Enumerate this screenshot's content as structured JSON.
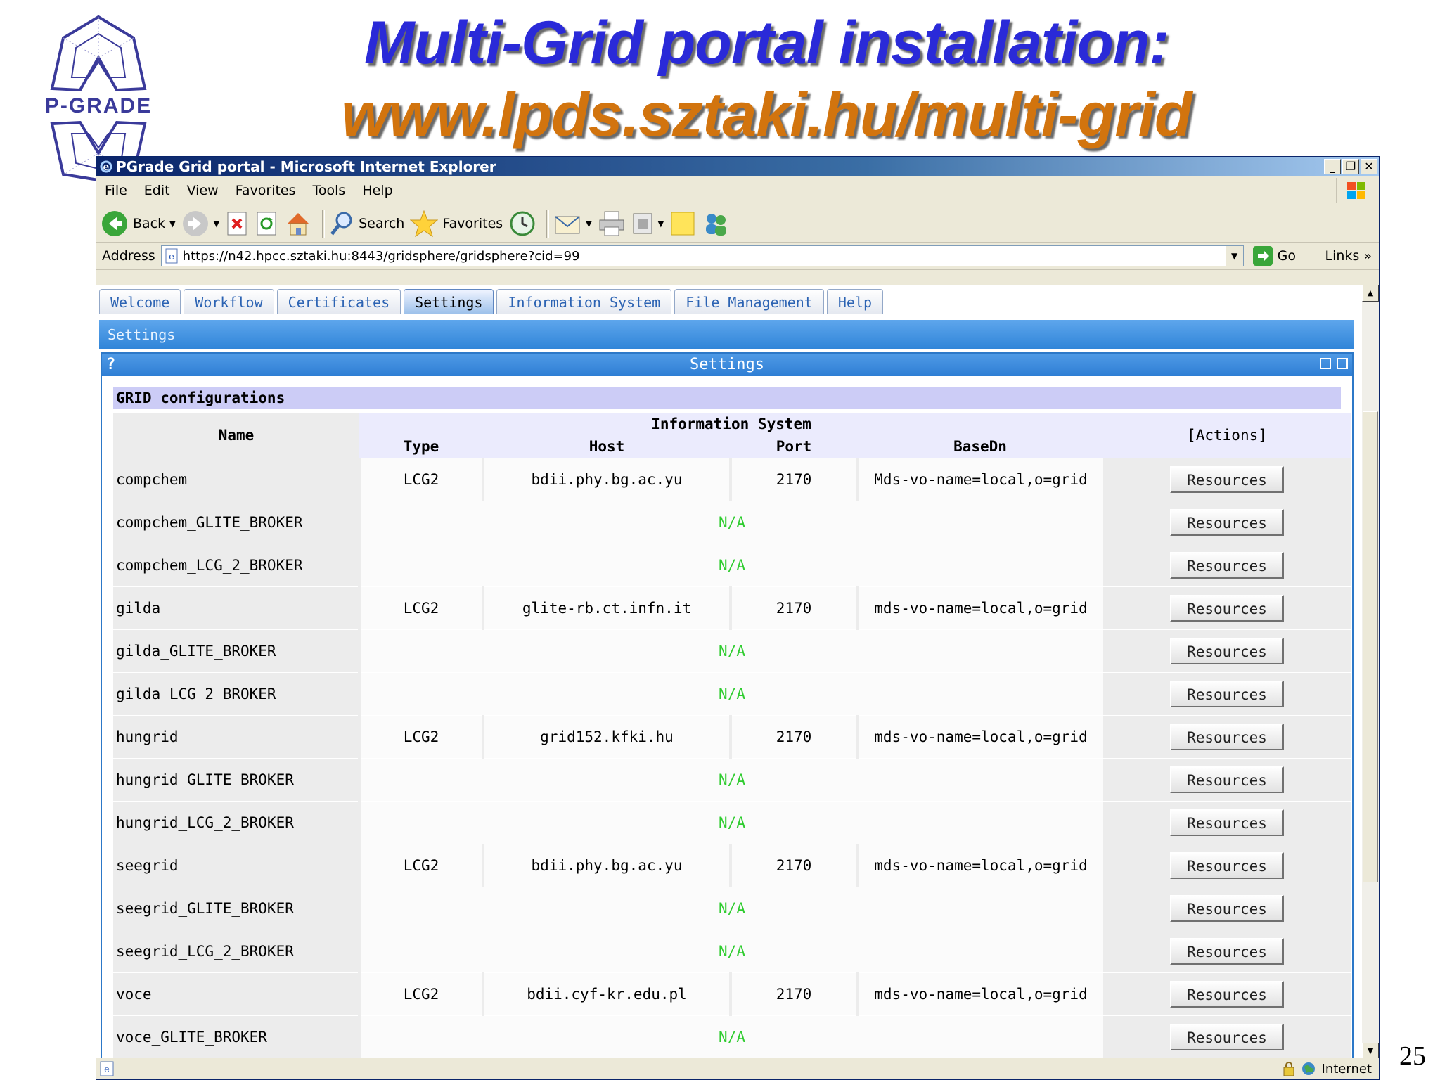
{
  "slide": {
    "logo_text": "P-GRADE",
    "title_line1": "Multi-Grid portal installation:",
    "title_line2": "www.lpds.sztaki.hu/multi-grid",
    "page_number": "25"
  },
  "window": {
    "title": "PGrade Grid portal - Microsoft Internet Explorer",
    "controls": [
      "_",
      "❐",
      "✕"
    ]
  },
  "menu": [
    "File",
    "Edit",
    "View",
    "Favorites",
    "Tools",
    "Help"
  ],
  "toolbar": {
    "back": "Back",
    "search": "Search",
    "favorites": "Favorites"
  },
  "address": {
    "label": "Address",
    "url": "https://n42.hpcc.sztaki.hu:8443/gridsphere/gridsphere?cid=99",
    "go": "Go",
    "links": "Links"
  },
  "tabs": [
    {
      "label": "Welcome",
      "active": false
    },
    {
      "label": "Workflow",
      "active": false
    },
    {
      "label": "Certificates",
      "active": false
    },
    {
      "label": "Settings",
      "active": true
    },
    {
      "label": "Information System",
      "active": false
    },
    {
      "label": "File Management",
      "active": false
    },
    {
      "label": "Help",
      "active": false
    }
  ],
  "breadcrumb": "Settings",
  "portlet": {
    "help": "?",
    "title": "Settings",
    "section": "GRID configurations"
  },
  "table": {
    "headers": {
      "name": "Name",
      "group": "Information System",
      "type": "Type",
      "host": "Host",
      "port": "Port",
      "basedn": "BaseDn",
      "actions": "[Actions]"
    },
    "na_text": "N/A",
    "button_label": "Resources",
    "rows": [
      {
        "name": "compchem",
        "type": "LCG2",
        "host": "bdii.phy.bg.ac.yu",
        "port": "2170",
        "basedn": "Mds-vo-name=local,o=grid"
      },
      {
        "name": "compchem_GLITE_BROKER",
        "na": true
      },
      {
        "name": "compchem_LCG_2_BROKER",
        "na": true
      },
      {
        "name": "gilda",
        "type": "LCG2",
        "host": "glite-rb.ct.infn.it",
        "port": "2170",
        "basedn": "mds-vo-name=local,o=grid"
      },
      {
        "name": "gilda_GLITE_BROKER",
        "na": true
      },
      {
        "name": "gilda_LCG_2_BROKER",
        "na": true
      },
      {
        "name": "hungrid",
        "type": "LCG2",
        "host": "grid152.kfki.hu",
        "port": "2170",
        "basedn": "mds-vo-name=local,o=grid"
      },
      {
        "name": "hungrid_GLITE_BROKER",
        "na": true
      },
      {
        "name": "hungrid_LCG_2_BROKER",
        "na": true
      },
      {
        "name": "seegrid",
        "type": "LCG2",
        "host": "bdii.phy.bg.ac.yu",
        "port": "2170",
        "basedn": "mds-vo-name=local,o=grid"
      },
      {
        "name": "seegrid_GLITE_BROKER",
        "na": true
      },
      {
        "name": "seegrid_LCG_2_BROKER",
        "na": true
      },
      {
        "name": "voce",
        "type": "LCG2",
        "host": "bdii.cyf-kr.edu.pl",
        "port": "2170",
        "basedn": "mds-vo-name=local,o=grid"
      },
      {
        "name": "voce_GLITE_BROKER",
        "na": true
      }
    ]
  },
  "status": {
    "zone": "Internet"
  },
  "colors": {
    "title1": "#2a2ad8",
    "title2": "#d2740e",
    "na_green": "#2fcc2f",
    "portlet_blue": "#2c78c8"
  }
}
